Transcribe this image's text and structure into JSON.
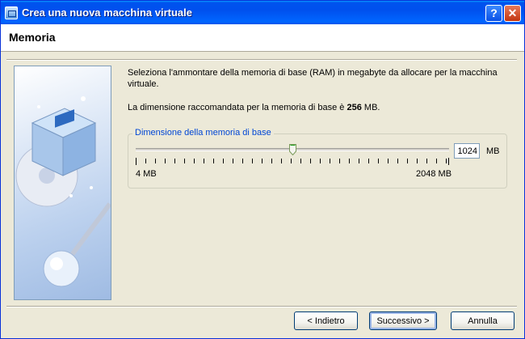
{
  "window": {
    "title": "Crea una nuova macchina virtuale",
    "help_glyph": "?",
    "close_glyph": "✕"
  },
  "page": {
    "title": "Memoria",
    "description": "Seleziona l'ammontare della memoria di base (RAM) in megabyte da allocare per la macchina virtuale.",
    "recommended_prefix": "La dimensione raccomandata per la memoria di base è ",
    "recommended_value": "256",
    "recommended_unit": " MB."
  },
  "memory": {
    "group_label": "Dimensione della memoria di base",
    "value": "1024",
    "unit": "MB",
    "min_label": "4 MB",
    "max_label": "2048 MB",
    "slider_fraction": 0.5
  },
  "buttons": {
    "back": "< Indietro",
    "next": "Successivo >",
    "cancel": "Annulla"
  },
  "colors": {
    "titlebar": "#0053ee",
    "group_label": "#0046d5",
    "dialog_bg": "#ece9d8"
  }
}
